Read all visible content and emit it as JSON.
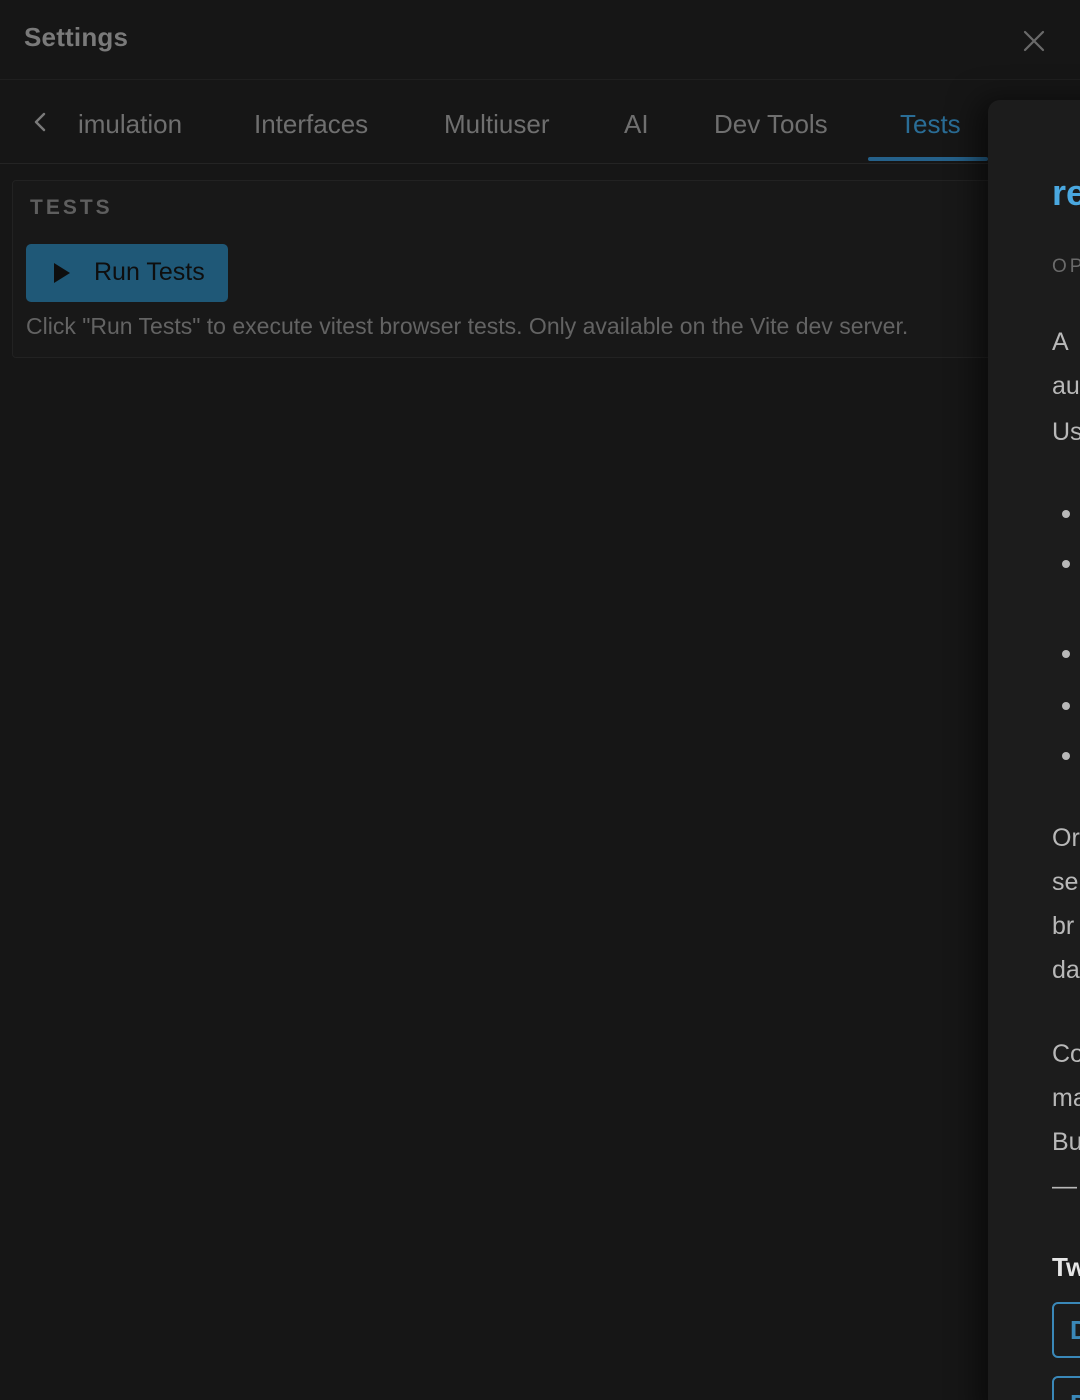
{
  "header": {
    "title": "Settings",
    "close_icon": "close-icon"
  },
  "tabs": {
    "back_icon": "chevron-left-icon",
    "items": [
      {
        "label": "imulation",
        "active": false
      },
      {
        "label": "Interfaces",
        "active": false
      },
      {
        "label": "Multiuser",
        "active": false
      },
      {
        "label": "AI",
        "active": false
      },
      {
        "label": "Dev Tools",
        "active": false
      },
      {
        "label": "Tests",
        "active": true
      }
    ],
    "active_color": "#2a6d96"
  },
  "tests": {
    "section_title": "TESTS",
    "run_button_label": "Run Tests",
    "run_button_icon": "play-icon",
    "help_text": "Click \"Run Tests\" to execute vitest browser tests. Only available on the Vite dev server."
  },
  "panel": {
    "title": "re",
    "subtitle": "OP",
    "paragraph1": [
      "A",
      "au",
      "Us"
    ],
    "bullet_count": 5,
    "paragraph2": [
      "Or",
      "se",
      "br",
      "da"
    ],
    "paragraph3": [
      "Co",
      "ma",
      "Bu",
      "—"
    ],
    "heading": "Tw",
    "buttons": [
      "D",
      "D"
    ],
    "accent_color": "#4aa8e0"
  }
}
